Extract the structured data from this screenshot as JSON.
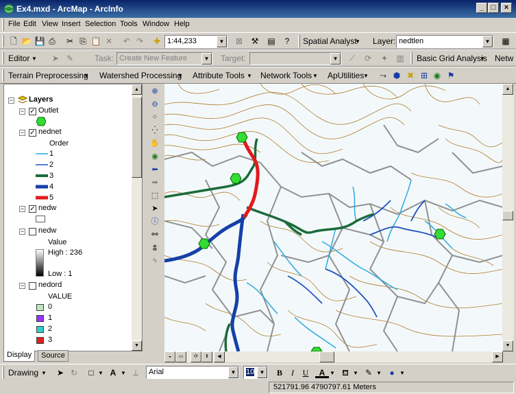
{
  "window": {
    "title": "Ex4.mxd - ArcMap - ArcInfo"
  },
  "menu": [
    "File",
    "Edit",
    "View",
    "Insert",
    "Selection",
    "Tools",
    "Window",
    "Help"
  ],
  "standard_toolbar": {
    "scale": "1:44,233",
    "spatial_analyst_label": "Spatial Analyst",
    "layer_label": "Layer:",
    "layer_value": "nedtlen"
  },
  "editor_toolbar": {
    "editor_label": "Editor",
    "task_label": "Task:",
    "task_value": "Create New Feature",
    "target_label": "Target:",
    "basic_grid_label": "Basic Grid Analysis",
    "netw_label": "Netw"
  },
  "archydro_toolbar": {
    "items": [
      "Terrain Preprocessing",
      "Watershed Processing",
      "Attribute Tools",
      "Network Tools",
      "ApUtilities"
    ]
  },
  "toc": {
    "root": "Layers",
    "outlet": "Outlet",
    "nednet": "nednet",
    "order_heading": "Order",
    "orders": [
      "1",
      "2",
      "3",
      "4",
      "5"
    ],
    "nedw1": "nedw",
    "nedw2": "nedw",
    "value_heading": "Value",
    "high_label": "High : 236",
    "low_label": "Low : 1",
    "nedord": "nedord",
    "value_caps": "VALUE",
    "ord_values": [
      "0",
      "1",
      "2",
      "3"
    ],
    "tab_display": "Display",
    "tab_source": "Source"
  },
  "draw_toolbar": {
    "drawing_label": "Drawing",
    "font": "Arial",
    "size": "10",
    "bold": "B",
    "italic": "I",
    "underline": "U"
  },
  "status": {
    "coordinates": "521791.96  4790797.61 Meters"
  },
  "colors": {
    "order1": "#2aa8e0",
    "order2": "#1f4fbf",
    "order3": "#1b6b3a",
    "order4": "#1540a8",
    "order5": "#e31a1c",
    "contour": "#b07a2a",
    "outlet": "#33dd33",
    "ord0": "#bfe6bf",
    "ord1": "#9933ff",
    "ord2": "#33cccc",
    "ord3": "#dd2222"
  }
}
